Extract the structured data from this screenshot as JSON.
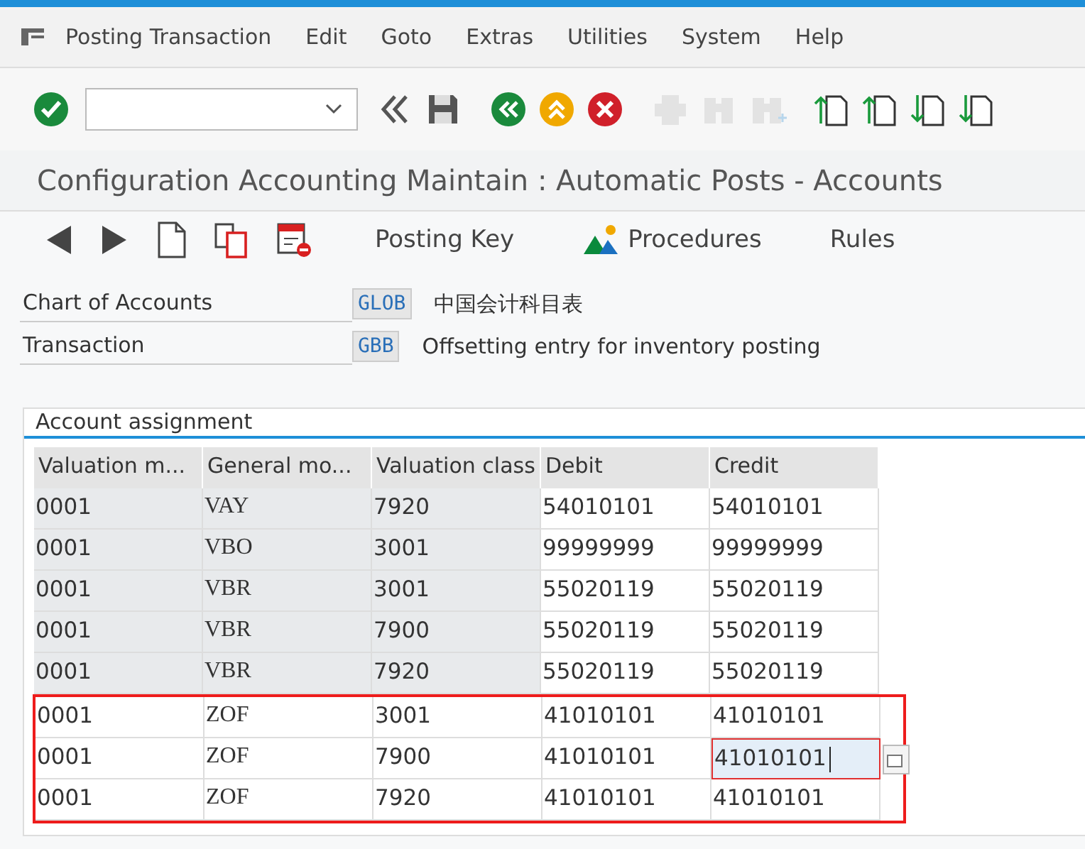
{
  "menu": [
    "Posting Transaction",
    "Edit",
    "Goto",
    "Extras",
    "Utilities",
    "System",
    "Help"
  ],
  "toolbar": [
    {
      "kind": "check",
      "disabled": false
    },
    {
      "kind": "command",
      "disabled": false
    },
    {
      "kind": "rewind",
      "disabled": false
    },
    {
      "kind": "save",
      "disabled": false
    },
    {
      "kind": "back",
      "disabled": false
    },
    {
      "kind": "exit",
      "disabled": false
    },
    {
      "kind": "cancel",
      "disabled": false
    },
    {
      "kind": "print",
      "disabled": true
    },
    {
      "kind": "find",
      "disabled": true
    },
    {
      "kind": "findnext",
      "disabled": true
    },
    {
      "kind": "first",
      "disabled": false
    },
    {
      "kind": "prev",
      "disabled": false
    },
    {
      "kind": "next",
      "disabled": false
    },
    {
      "kind": "last",
      "disabled": false
    }
  ],
  "title": "Configuration Accounting Maintain : Automatic Posts - Accounts",
  "app_toolbar": [
    {
      "kind": "left"
    },
    {
      "kind": "right"
    },
    {
      "kind": "new"
    },
    {
      "kind": "copy"
    },
    {
      "kind": "delete"
    },
    {
      "kind": "text",
      "label": "Posting Key"
    },
    {
      "kind": "procedures",
      "label": "Procedures"
    },
    {
      "kind": "text",
      "label": "Rules"
    }
  ],
  "fields": [
    {
      "label": "Chart of Accounts",
      "value": "GLOB",
      "description": "中国会计科目表"
    },
    {
      "label": "Transaction",
      "value": "GBB",
      "description": "Offsetting entry for inventory posting"
    }
  ],
  "group_title": "Account assignment",
  "table": {
    "columns": [
      "Valuation m...",
      "General mo...",
      "Valuation class",
      "Debit",
      "Credit"
    ],
    "rows": [
      {
        "cells": [
          "0001",
          "VAY",
          "7920",
          "54010101",
          "54010101"
        ],
        "new": false,
        "highlighted": false,
        "focused": false
      },
      {
        "cells": [
          "0001",
          "VBO",
          "3001",
          "99999999",
          "99999999"
        ],
        "new": false,
        "highlighted": false,
        "focused": false
      },
      {
        "cells": [
          "0001",
          "VBR",
          "3001",
          "55020119",
          "55020119"
        ],
        "new": false,
        "highlighted": false,
        "focused": false
      },
      {
        "cells": [
          "0001",
          "VBR",
          "7900",
          "55020119",
          "55020119"
        ],
        "new": false,
        "highlighted": false,
        "focused": false
      },
      {
        "cells": [
          "0001",
          "VBR",
          "7920",
          "55020119",
          "55020119"
        ],
        "new": false,
        "highlighted": false,
        "focused": false
      },
      {
        "cells": [
          "0001",
          "ZOF",
          "3001",
          "41010101",
          "41010101"
        ],
        "new": true,
        "highlighted": true,
        "focused": false
      },
      {
        "cells": [
          "0001",
          "ZOF",
          "7900",
          "41010101",
          "41010101"
        ],
        "new": true,
        "highlighted": true,
        "focused": true
      },
      {
        "cells": [
          "0001",
          "ZOF",
          "7920",
          "41010101",
          "41010101"
        ],
        "new": true,
        "highlighted": true,
        "focused": false
      }
    ]
  }
}
